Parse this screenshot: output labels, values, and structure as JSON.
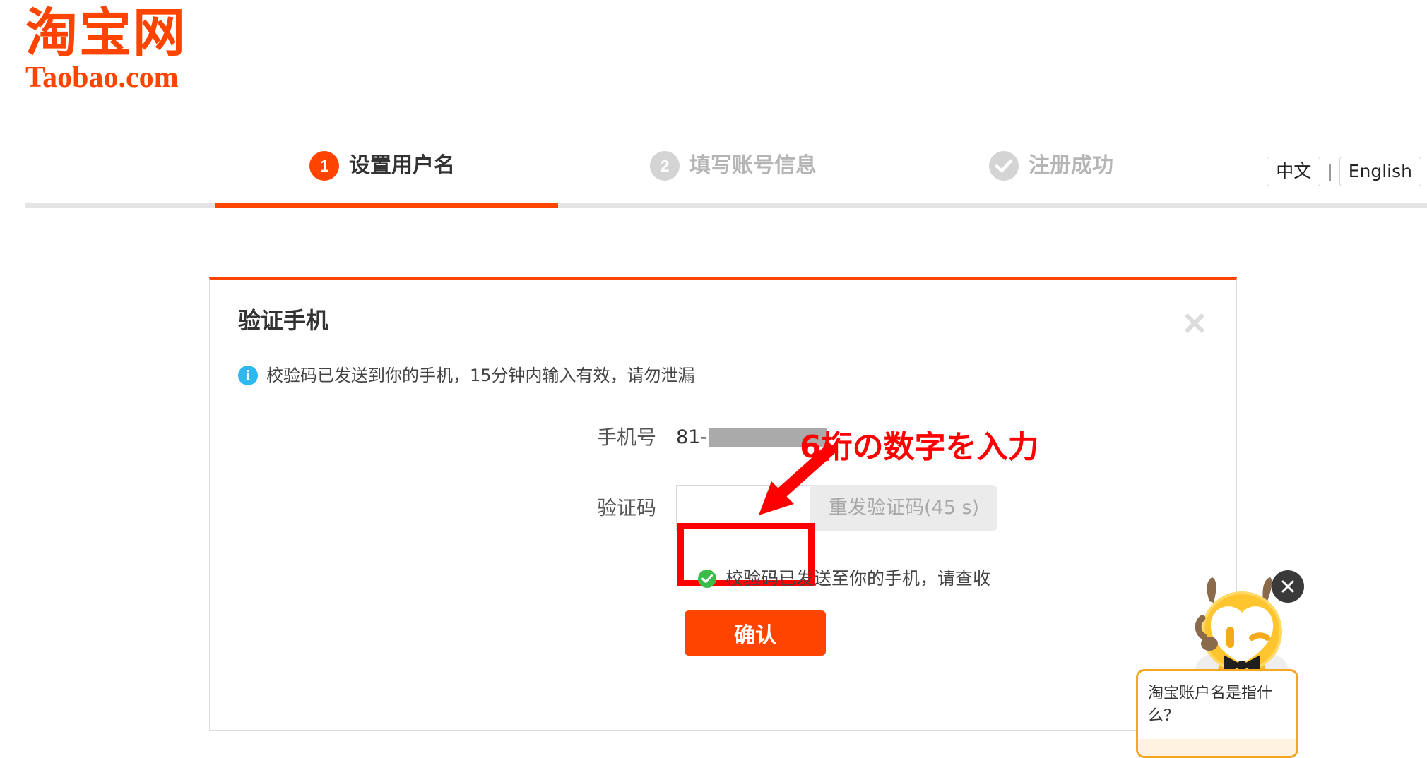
{
  "brand": {
    "logo_cn": "淘宝网",
    "logo_en": "Taobao.com",
    "accent_color": "#ff4400"
  },
  "steps": [
    {
      "badge": "1",
      "label": "设置用户名",
      "state": "active"
    },
    {
      "badge": "2",
      "label": "填写账号信息",
      "state": "inactive"
    },
    {
      "badge": "check-icon",
      "label": "注册成功",
      "state": "inactive"
    }
  ],
  "language": {
    "chinese": "中文",
    "separator": "|",
    "english": "English"
  },
  "dialog": {
    "title": "验证手机",
    "close_icon": "close-icon",
    "info": {
      "icon": "info-icon",
      "text": "校验码已发送到你的手机，15分钟内输入有效，请勿泄漏"
    },
    "phone": {
      "label": "手机号",
      "country_code": "81-",
      "number_redacted": true
    },
    "code": {
      "label": "验证码",
      "value": "",
      "placeholder": "",
      "resend_label": "重发验证码(45 s)",
      "resend_disabled": true,
      "countdown_seconds": "45"
    },
    "success": {
      "icon": "check-circle-icon",
      "text": "校验码已发送至你的手机，请查收",
      "color": "#3dbb4a"
    },
    "confirm_label": "确认"
  },
  "annotation": {
    "text": "6桁の数字を入力",
    "color": "#ff0000",
    "arrow": "arrow-down-left-icon",
    "highlight": "red-box-around-code-input"
  },
  "chat_widget": {
    "mascot": "taobao-mascot-icon",
    "close_icon": "close-icon",
    "bubble_text": "淘宝账户名是指什么？"
  }
}
